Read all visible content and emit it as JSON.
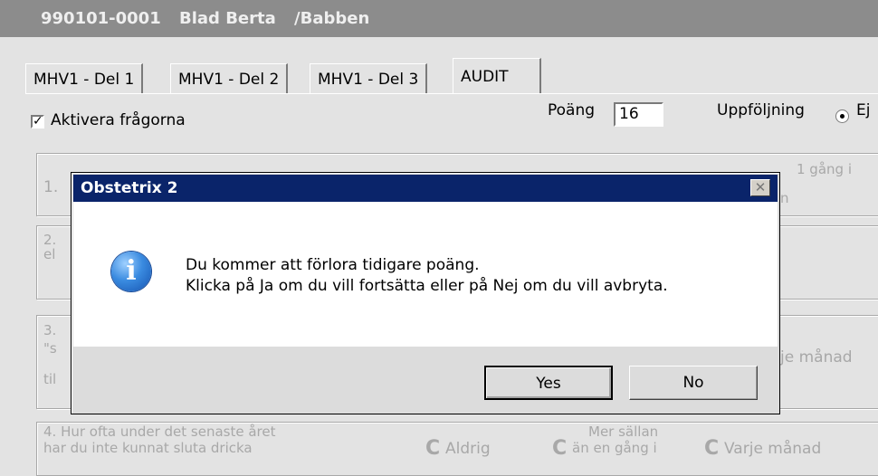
{
  "patient": {
    "id": "990101-0001",
    "name": "Blad Berta",
    "alias": "/Babben"
  },
  "tabs": [
    {
      "label": "MHV1 - Del 1"
    },
    {
      "label": "MHV1 - Del 2"
    },
    {
      "label": "MHV1 - Del 3"
    },
    {
      "label": "AUDIT"
    }
  ],
  "panel": {
    "activate_label": "Aktivera frågorna",
    "score_label": "Poäng",
    "score_value": "16",
    "followup_label": "Uppföljning",
    "followup_option": "Ej"
  },
  "questions": {
    "q1_prefix": "1.",
    "q1_right_line1": "1 gång i",
    "q1_right_line2": "n",
    "q2_line1": "2.",
    "q2_line2": "el",
    "q3_line1": "3.",
    "q3_line2": "\"s",
    "q3_line3": "til",
    "q3_right": "je månad",
    "q4_line1": "4. Hur ofta under det senaste året",
    "q4_line2": "har du inte kunnat sluta dricka",
    "q4_opt1": "Aldrig",
    "q4_opt2_line1": "Mer sällan",
    "q4_opt2_line2": "än en gång i",
    "q4_opt3": "Varje månad"
  },
  "dialog": {
    "title": "Obstetrix 2",
    "close_glyph": "✕",
    "message_line1": "Du kommer att förlora tidigare poäng.",
    "message_line2": "Klicka på Ja om du vill fortsätta eller på Nej om du vill avbryta.",
    "yes_label": "Yes",
    "no_label": "No",
    "icon": "information-icon"
  },
  "colors": {
    "title_bar": "#0a246a",
    "patient_bar": "#8c8c8c",
    "background": "#e3e3e3"
  }
}
